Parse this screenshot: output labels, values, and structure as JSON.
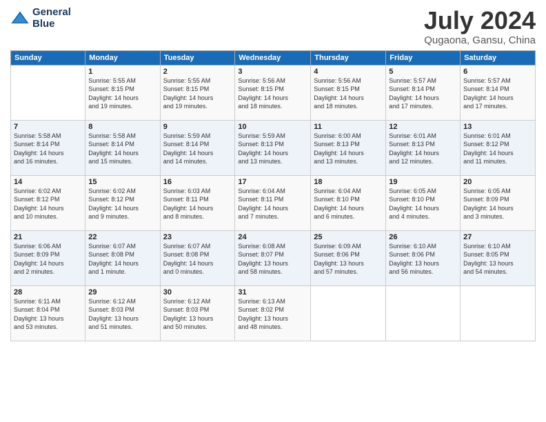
{
  "logo": {
    "line1": "General",
    "line2": "Blue"
  },
  "title": "July 2024",
  "subtitle": "Qugaona, Gansu, China",
  "weekdays": [
    "Sunday",
    "Monday",
    "Tuesday",
    "Wednesday",
    "Thursday",
    "Friday",
    "Saturday"
  ],
  "weeks": [
    [
      {
        "day": "",
        "info": ""
      },
      {
        "day": "1",
        "info": "Sunrise: 5:55 AM\nSunset: 8:15 PM\nDaylight: 14 hours\nand 19 minutes."
      },
      {
        "day": "2",
        "info": "Sunrise: 5:55 AM\nSunset: 8:15 PM\nDaylight: 14 hours\nand 19 minutes."
      },
      {
        "day": "3",
        "info": "Sunrise: 5:56 AM\nSunset: 8:15 PM\nDaylight: 14 hours\nand 18 minutes."
      },
      {
        "day": "4",
        "info": "Sunrise: 5:56 AM\nSunset: 8:15 PM\nDaylight: 14 hours\nand 18 minutes."
      },
      {
        "day": "5",
        "info": "Sunrise: 5:57 AM\nSunset: 8:14 PM\nDaylight: 14 hours\nand 17 minutes."
      },
      {
        "day": "6",
        "info": "Sunrise: 5:57 AM\nSunset: 8:14 PM\nDaylight: 14 hours\nand 17 minutes."
      }
    ],
    [
      {
        "day": "7",
        "info": "Sunrise: 5:58 AM\nSunset: 8:14 PM\nDaylight: 14 hours\nand 16 minutes."
      },
      {
        "day": "8",
        "info": "Sunrise: 5:58 AM\nSunset: 8:14 PM\nDaylight: 14 hours\nand 15 minutes."
      },
      {
        "day": "9",
        "info": "Sunrise: 5:59 AM\nSunset: 8:14 PM\nDaylight: 14 hours\nand 14 minutes."
      },
      {
        "day": "10",
        "info": "Sunrise: 5:59 AM\nSunset: 8:13 PM\nDaylight: 14 hours\nand 13 minutes."
      },
      {
        "day": "11",
        "info": "Sunrise: 6:00 AM\nSunset: 8:13 PM\nDaylight: 14 hours\nand 13 minutes."
      },
      {
        "day": "12",
        "info": "Sunrise: 6:01 AM\nSunset: 8:13 PM\nDaylight: 14 hours\nand 12 minutes."
      },
      {
        "day": "13",
        "info": "Sunrise: 6:01 AM\nSunset: 8:12 PM\nDaylight: 14 hours\nand 11 minutes."
      }
    ],
    [
      {
        "day": "14",
        "info": "Sunrise: 6:02 AM\nSunset: 8:12 PM\nDaylight: 14 hours\nand 10 minutes."
      },
      {
        "day": "15",
        "info": "Sunrise: 6:02 AM\nSunset: 8:12 PM\nDaylight: 14 hours\nand 9 minutes."
      },
      {
        "day": "16",
        "info": "Sunrise: 6:03 AM\nSunset: 8:11 PM\nDaylight: 14 hours\nand 8 minutes."
      },
      {
        "day": "17",
        "info": "Sunrise: 6:04 AM\nSunset: 8:11 PM\nDaylight: 14 hours\nand 7 minutes."
      },
      {
        "day": "18",
        "info": "Sunrise: 6:04 AM\nSunset: 8:10 PM\nDaylight: 14 hours\nand 6 minutes."
      },
      {
        "day": "19",
        "info": "Sunrise: 6:05 AM\nSunset: 8:10 PM\nDaylight: 14 hours\nand 4 minutes."
      },
      {
        "day": "20",
        "info": "Sunrise: 6:05 AM\nSunset: 8:09 PM\nDaylight: 14 hours\nand 3 minutes."
      }
    ],
    [
      {
        "day": "21",
        "info": "Sunrise: 6:06 AM\nSunset: 8:09 PM\nDaylight: 14 hours\nand 2 minutes."
      },
      {
        "day": "22",
        "info": "Sunrise: 6:07 AM\nSunset: 8:08 PM\nDaylight: 14 hours\nand 1 minute."
      },
      {
        "day": "23",
        "info": "Sunrise: 6:07 AM\nSunset: 8:08 PM\nDaylight: 14 hours\nand 0 minutes."
      },
      {
        "day": "24",
        "info": "Sunrise: 6:08 AM\nSunset: 8:07 PM\nDaylight: 13 hours\nand 58 minutes."
      },
      {
        "day": "25",
        "info": "Sunrise: 6:09 AM\nSunset: 8:06 PM\nDaylight: 13 hours\nand 57 minutes."
      },
      {
        "day": "26",
        "info": "Sunrise: 6:10 AM\nSunset: 8:06 PM\nDaylight: 13 hours\nand 56 minutes."
      },
      {
        "day": "27",
        "info": "Sunrise: 6:10 AM\nSunset: 8:05 PM\nDaylight: 13 hours\nand 54 minutes."
      }
    ],
    [
      {
        "day": "28",
        "info": "Sunrise: 6:11 AM\nSunset: 8:04 PM\nDaylight: 13 hours\nand 53 minutes."
      },
      {
        "day": "29",
        "info": "Sunrise: 6:12 AM\nSunset: 8:03 PM\nDaylight: 13 hours\nand 51 minutes."
      },
      {
        "day": "30",
        "info": "Sunrise: 6:12 AM\nSunset: 8:03 PM\nDaylight: 13 hours\nand 50 minutes."
      },
      {
        "day": "31",
        "info": "Sunrise: 6:13 AM\nSunset: 8:02 PM\nDaylight: 13 hours\nand 48 minutes."
      },
      {
        "day": "",
        "info": ""
      },
      {
        "day": "",
        "info": ""
      },
      {
        "day": "",
        "info": ""
      }
    ]
  ]
}
